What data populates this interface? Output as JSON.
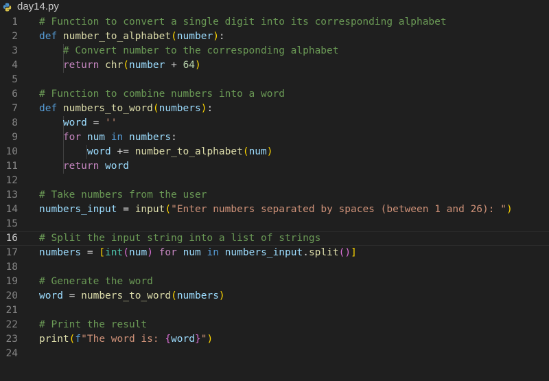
{
  "tab": {
    "filename": "day14.py",
    "icon": "python-file-icon"
  },
  "editor": {
    "current_line": 16,
    "lines": [
      {
        "n": "1",
        "indent": 0,
        "tokens": [
          {
            "c": "cm",
            "t": "# Function to convert a single digit into its corresponding alphabet"
          }
        ]
      },
      {
        "n": "2",
        "indent": 0,
        "tokens": [
          {
            "c": "kw",
            "t": "def "
          },
          {
            "c": "fn",
            "t": "number_to_alphabet"
          },
          {
            "c": "b1",
            "t": "("
          },
          {
            "c": "pr",
            "t": "number"
          },
          {
            "c": "b1",
            "t": ")"
          },
          {
            "c": "tx",
            "t": ":"
          }
        ]
      },
      {
        "n": "3",
        "indent": 1,
        "tokens": [
          {
            "c": "cm",
            "t": "    # Convert number to the corresponding alphabet"
          }
        ]
      },
      {
        "n": "4",
        "indent": 1,
        "tokens": [
          {
            "c": "ctl",
            "t": "    return "
          },
          {
            "c": "fn",
            "t": "chr"
          },
          {
            "c": "b1",
            "t": "("
          },
          {
            "c": "pr",
            "t": "number"
          },
          {
            "c": "tx",
            "t": " + "
          },
          {
            "c": "nm",
            "t": "64"
          },
          {
            "c": "b1",
            "t": ")"
          }
        ]
      },
      {
        "n": "5",
        "indent": 0,
        "tokens": []
      },
      {
        "n": "6",
        "indent": 0,
        "tokens": [
          {
            "c": "cm",
            "t": "# Function to combine numbers into a word"
          }
        ]
      },
      {
        "n": "7",
        "indent": 0,
        "tokens": [
          {
            "c": "kw",
            "t": "def "
          },
          {
            "c": "fn",
            "t": "numbers_to_word"
          },
          {
            "c": "b1",
            "t": "("
          },
          {
            "c": "pr",
            "t": "numbers"
          },
          {
            "c": "b1",
            "t": ")"
          },
          {
            "c": "tx",
            "t": ":"
          }
        ]
      },
      {
        "n": "8",
        "indent": 1,
        "tokens": [
          {
            "c": "pr",
            "t": "    word"
          },
          {
            "c": "tx",
            "t": " = "
          },
          {
            "c": "st",
            "t": "''"
          }
        ]
      },
      {
        "n": "9",
        "indent": 1,
        "tokens": [
          {
            "c": "ctl",
            "t": "    for "
          },
          {
            "c": "pr",
            "t": "num"
          },
          {
            "c": "kw",
            "t": " in "
          },
          {
            "c": "pr",
            "t": "numbers"
          },
          {
            "c": "tx",
            "t": ":"
          }
        ]
      },
      {
        "n": "10",
        "indent": 2,
        "tokens": [
          {
            "c": "pr",
            "t": "        word"
          },
          {
            "c": "tx",
            "t": " += "
          },
          {
            "c": "fn",
            "t": "number_to_alphabet"
          },
          {
            "c": "b1",
            "t": "("
          },
          {
            "c": "pr",
            "t": "num"
          },
          {
            "c": "b1",
            "t": ")"
          }
        ]
      },
      {
        "n": "11",
        "indent": 1,
        "tokens": [
          {
            "c": "ctl",
            "t": "    return "
          },
          {
            "c": "pr",
            "t": "word"
          }
        ]
      },
      {
        "n": "12",
        "indent": 0,
        "tokens": []
      },
      {
        "n": "13",
        "indent": 0,
        "tokens": [
          {
            "c": "cm",
            "t": "# Take numbers from the user"
          }
        ]
      },
      {
        "n": "14",
        "indent": 0,
        "tokens": [
          {
            "c": "pr",
            "t": "numbers_input"
          },
          {
            "c": "tx",
            "t": " = "
          },
          {
            "c": "fn",
            "t": "input"
          },
          {
            "c": "b1",
            "t": "("
          },
          {
            "c": "st",
            "t": "\"Enter numbers separated by spaces (between 1 and 26): \""
          },
          {
            "c": "b1",
            "t": ")"
          }
        ]
      },
      {
        "n": "15",
        "indent": 0,
        "tokens": []
      },
      {
        "n": "16",
        "indent": 0,
        "tokens": [
          {
            "c": "cm",
            "t": "# Split the input string into a list of strings"
          }
        ]
      },
      {
        "n": "17",
        "indent": 0,
        "tokens": [
          {
            "c": "pr",
            "t": "numbers"
          },
          {
            "c": "tx",
            "t": " = "
          },
          {
            "c": "b1",
            "t": "["
          },
          {
            "c": "bi",
            "t": "int"
          },
          {
            "c": "b2",
            "t": "("
          },
          {
            "c": "pr",
            "t": "num"
          },
          {
            "c": "b2",
            "t": ")"
          },
          {
            "c": "ctl",
            "t": " for "
          },
          {
            "c": "pr",
            "t": "num"
          },
          {
            "c": "kw",
            "t": " in "
          },
          {
            "c": "pr",
            "t": "numbers_input"
          },
          {
            "c": "tx",
            "t": "."
          },
          {
            "c": "fn",
            "t": "split"
          },
          {
            "c": "b2",
            "t": "()"
          },
          {
            "c": "b1",
            "t": "]"
          }
        ]
      },
      {
        "n": "18",
        "indent": 0,
        "tokens": []
      },
      {
        "n": "19",
        "indent": 0,
        "tokens": [
          {
            "c": "cm",
            "t": "# Generate the word"
          }
        ]
      },
      {
        "n": "20",
        "indent": 0,
        "tokens": [
          {
            "c": "pr",
            "t": "word"
          },
          {
            "c": "tx",
            "t": " = "
          },
          {
            "c": "fn",
            "t": "numbers_to_word"
          },
          {
            "c": "b1",
            "t": "("
          },
          {
            "c": "pr",
            "t": "numbers"
          },
          {
            "c": "b1",
            "t": ")"
          }
        ]
      },
      {
        "n": "21",
        "indent": 0,
        "tokens": []
      },
      {
        "n": "22",
        "indent": 0,
        "tokens": [
          {
            "c": "cm",
            "t": "# Print the result"
          }
        ]
      },
      {
        "n": "23",
        "indent": 0,
        "tokens": [
          {
            "c": "fn",
            "t": "print"
          },
          {
            "c": "b1",
            "t": "("
          },
          {
            "c": "kw",
            "t": "f"
          },
          {
            "c": "st",
            "t": "\"The word is: "
          },
          {
            "c": "b2",
            "t": "{"
          },
          {
            "c": "pr",
            "t": "word"
          },
          {
            "c": "b2",
            "t": "}"
          },
          {
            "c": "st",
            "t": "\""
          },
          {
            "c": "b1",
            "t": ")"
          }
        ]
      },
      {
        "n": "24",
        "indent": 0,
        "tokens": []
      }
    ]
  }
}
